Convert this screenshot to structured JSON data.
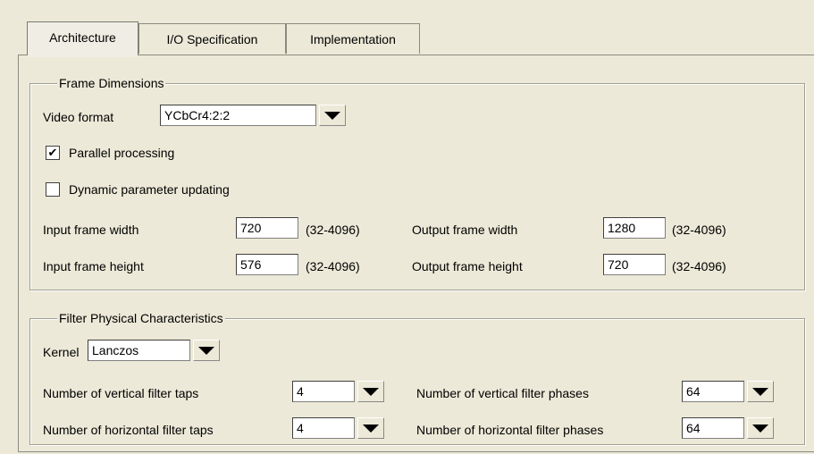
{
  "tabs": [
    {
      "label": "Architecture",
      "active": true
    },
    {
      "label": "I/O Specification",
      "active": false
    },
    {
      "label": "Implementation",
      "active": false
    }
  ],
  "frame_dimensions": {
    "legend": "Frame Dimensions",
    "video_format_label": "Video format",
    "video_format_value": "YCbCr4:2:2",
    "parallel_processing_label": "Parallel processing",
    "parallel_processing_checked": true,
    "parallel_processing_mark": "✔",
    "dynamic_updating_label": "Dynamic parameter updating",
    "dynamic_updating_checked": false,
    "input_width_label": "Input frame width",
    "input_width_value": "720",
    "input_width_range": "(32-4096)",
    "input_height_label": "Input frame height",
    "input_height_value": "576",
    "input_height_range": "(32-4096)",
    "output_width_label": "Output frame width",
    "output_width_value": "1280",
    "output_width_range": "(32-4096)",
    "output_height_label": "Output frame height",
    "output_height_value": "720",
    "output_height_range": "(32-4096)"
  },
  "filter": {
    "legend": "Filter Physical Characteristics",
    "kernel_label": "Kernel",
    "kernel_value": "Lanczos",
    "vertical_taps_label": "Number of vertical filter taps",
    "vertical_taps_value": "4",
    "horizontal_taps_label": "Number of horizontal filter taps",
    "horizontal_taps_value": "4",
    "vertical_phases_label": "Number of vertical filter phases",
    "vertical_phases_value": "64",
    "horizontal_phases_label": "Number of horizontal filter phases",
    "horizontal_phases_value": "64"
  },
  "icons": {
    "dropdown": "chevron-down-icon",
    "checkbox_mark": "checkmark-icon"
  }
}
